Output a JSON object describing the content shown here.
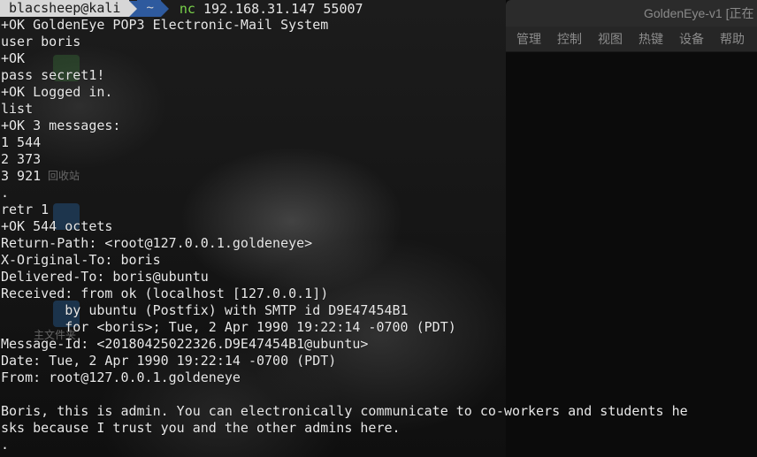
{
  "desktop": {
    "icons": [
      {
        "label": "回收站",
        "icon": "trash-icon"
      },
      {
        "label": "主文件夹",
        "icon": "folder-home-icon"
      }
    ]
  },
  "vm_window": {
    "title": "GoldenEye-v1 [正在",
    "menu": [
      "管理",
      "控制",
      "视图",
      "热键",
      "设备",
      "帮助"
    ]
  },
  "terminal": {
    "prompt": {
      "user_host": "blacsheep@kali",
      "directory": "~",
      "command": "nc",
      "args": "192.168.31.147 55007"
    },
    "lines": [
      "+OK GoldenEye POP3 Electronic-Mail System",
      "user boris",
      "+OK",
      "pass secret1!",
      "+OK Logged in.",
      "list",
      "+OK 3 messages:",
      "1 544",
      "2 373",
      "3 921",
      ".",
      "retr 1",
      "+OK 544 octets",
      "Return-Path: <root@127.0.0.1.goldeneye>",
      "X-Original-To: boris",
      "Delivered-To: boris@ubuntu",
      "Received: from ok (localhost [127.0.0.1])",
      "        by ubuntu (Postfix) with SMTP id D9E47454B1",
      "        for <boris>; Tue, 2 Apr 1990 19:22:14 -0700 (PDT)",
      "Message-Id: <20180425022326.D9E47454B1@ubuntu>",
      "Date: Tue, 2 Apr 1990 19:22:14 -0700 (PDT)",
      "From: root@127.0.0.1.goldeneye",
      "",
      "Boris, this is admin. You can electronically communicate to co-workers and students he",
      "sks because I trust you and the other admins here.",
      "."
    ]
  }
}
